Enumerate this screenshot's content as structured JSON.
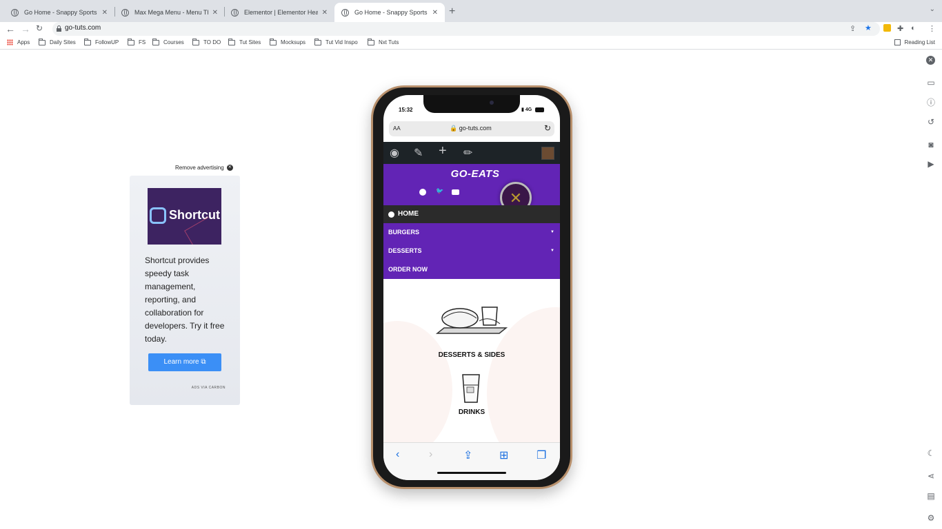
{
  "browser": {
    "tabs": [
      {
        "title": "Go Home - Snappy Sports",
        "active": false
      },
      {
        "title": "Max Mega Menu - Menu Theme",
        "active": false
      },
      {
        "title": "Elementor | Elementor Header",
        "active": false
      },
      {
        "title": "Go Home - Snappy Sports",
        "active": true
      }
    ],
    "url": "go-tuts.com",
    "bookmarks": [
      "Apps",
      "Daily Sites",
      "FollowUP",
      "FS",
      "Courses",
      "TO DO",
      "Tut Sites",
      "Mocksups",
      "Tut Vid Inspo",
      "Nxt Tuts"
    ],
    "reading_list": "Reading List"
  },
  "ad": {
    "remove_label": "Remove advertising",
    "brand": "Shortcut",
    "text": "Shortcut provides speedy task management, reporting, and collaboration for developers. Try it free today.",
    "button": "Learn more",
    "via": "ADS VIA CARBON"
  },
  "phone": {
    "time": "15:32",
    "signal": "4G",
    "safari_aa": "AA",
    "safari_url": "go-tuts.com",
    "site_title": "GO-EATS",
    "menu": {
      "home": "HOME",
      "items": [
        "BURGERS",
        "DESSERTS",
        "ORDER NOW"
      ]
    },
    "categories": [
      "DESSERTS & SIDES",
      "DRINKS"
    ]
  },
  "colors": {
    "brand_purple": "#6224b5",
    "admin_bar": "#1d2327",
    "ad_button": "#3b8ff6",
    "safari_blue": "#1a6fe0"
  }
}
